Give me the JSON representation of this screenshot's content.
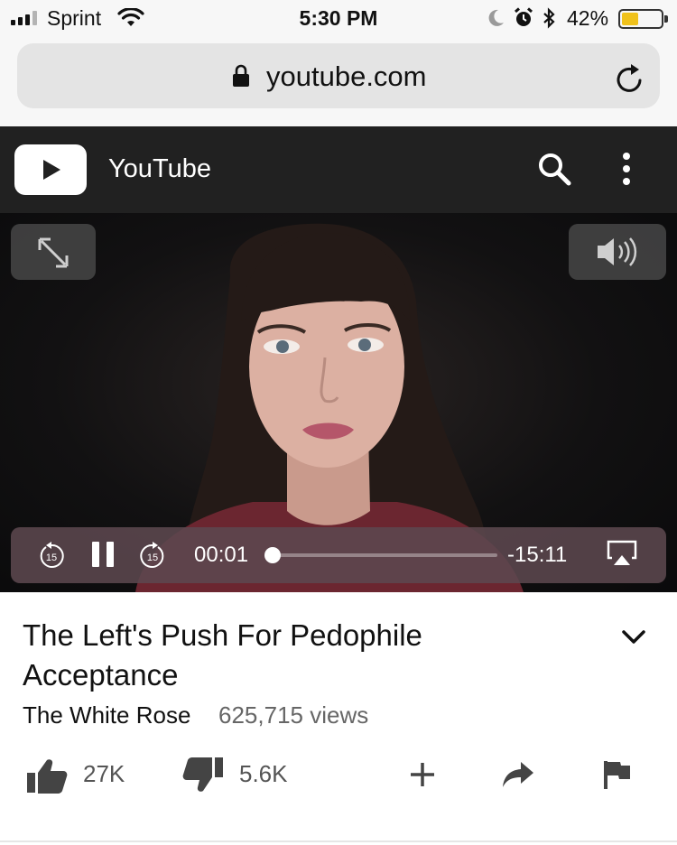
{
  "status_bar": {
    "carrier": "Sprint",
    "time": "5:30 PM",
    "battery_percent": "42%",
    "battery_level": 0.42,
    "signal_bars_filled": 3,
    "signal_bars_total": 4,
    "icons": [
      "signal-icon",
      "wifi-icon",
      "moon-icon",
      "alarm-icon",
      "bluetooth-icon",
      "battery-icon"
    ]
  },
  "browser": {
    "url": "youtube.com",
    "icons": [
      "lock-icon",
      "reload-icon"
    ]
  },
  "header": {
    "title": "YouTube",
    "icons": [
      "youtube-logo-icon",
      "search-icon",
      "more-vert-icon"
    ]
  },
  "player": {
    "elapsed": "00:01",
    "remaining": "-15:11",
    "skip_back_label": "15",
    "skip_forward_label": "15",
    "progress": 0.005,
    "icons": [
      "fullscreen-icon",
      "volume-icon",
      "skip-back-15-icon",
      "pause-icon",
      "skip-forward-15-icon",
      "airplay-icon"
    ]
  },
  "video": {
    "title": "The Left's Push For Pedophile Acceptance",
    "channel": "The White Rose",
    "views": "625,715 views"
  },
  "actions": {
    "likes": "27K",
    "dislikes": "5.6K",
    "icons": [
      "thumbs-up-icon",
      "thumbs-down-icon",
      "add-to-playlist-icon",
      "share-icon",
      "flag-icon",
      "chevron-down-icon"
    ]
  },
  "colors": {
    "header_bg": "#212121",
    "url_bar_bg": "#e4e4e4",
    "battery_fill": "#f0c21c",
    "controls_bg": "#5c484e"
  }
}
